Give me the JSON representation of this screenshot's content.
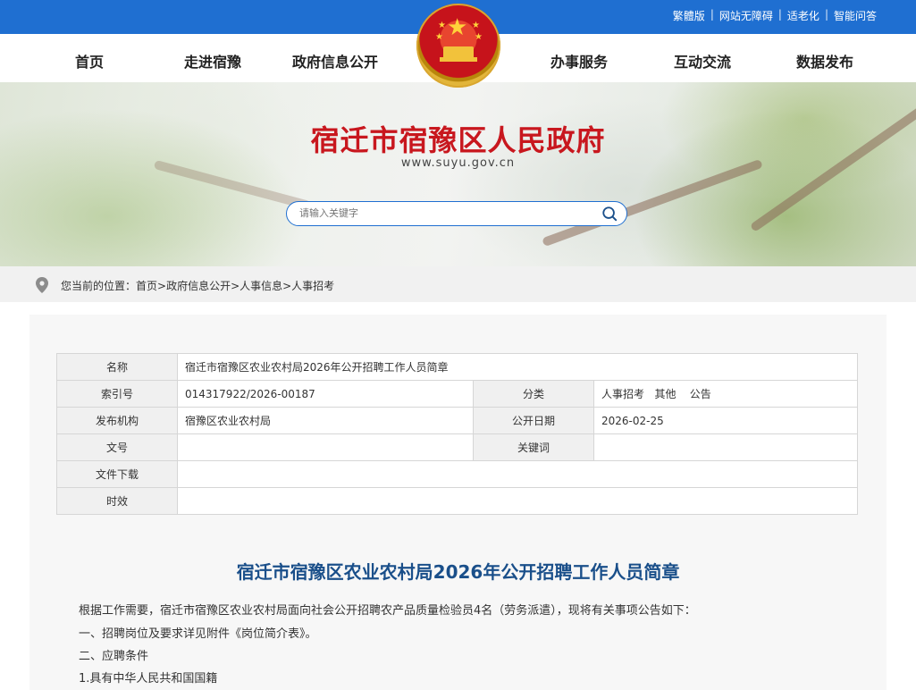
{
  "top_links": [
    "繁體版",
    "网站无障碍",
    "适老化",
    "智能问答"
  ],
  "nav": {
    "left": [
      "首页",
      "走进宿豫",
      "政府信息公开"
    ],
    "right": [
      "办事服务",
      "互动交流",
      "数据发布"
    ]
  },
  "banner": {
    "title": "宿迁市宿豫区人民政府",
    "url": "www.suyu.gov.cn",
    "search_placeholder": "请输入关键字"
  },
  "breadcrumb": {
    "prefix": "您当前的位置：",
    "path": "首页>政府信息公开>人事信息>人事招考"
  },
  "meta": {
    "name_label": "名称",
    "name_value": "宿迁市宿豫区农业农村局2026年公开招聘工作人员简章",
    "index_label": "索引号",
    "index_value": "014317922/2026-00187",
    "category_label": "分类",
    "category_value": "人事招考   其他    公告",
    "publisher_label": "发布机构",
    "publisher_value": "宿豫区农业农村局",
    "date_label": "公开日期",
    "date_value": "2026-02-25",
    "docno_label": "文号",
    "docno_value": "",
    "keywords_label": "关键词",
    "keywords_value": "",
    "download_label": "文件下载",
    "download_value": "",
    "validity_label": "时效",
    "validity_value": ""
  },
  "article": {
    "title": "宿迁市宿豫区农业农村局2026年公开招聘工作人员简章",
    "p1": "根据工作需要，宿迁市宿豫区农业农村局面向社会公开招聘农产品质量检验员4名（劳务派遣），现将有关事项公告如下：",
    "p2": "一、招聘岗位及要求详见附件《岗位简介表》。",
    "p3": "二、应聘条件",
    "p4": "1.具有中华人民共和国国籍"
  },
  "colors": {
    "topbar": "#1f6fd1",
    "site_title": "#c8171e",
    "article_title": "#1a4f8a"
  }
}
